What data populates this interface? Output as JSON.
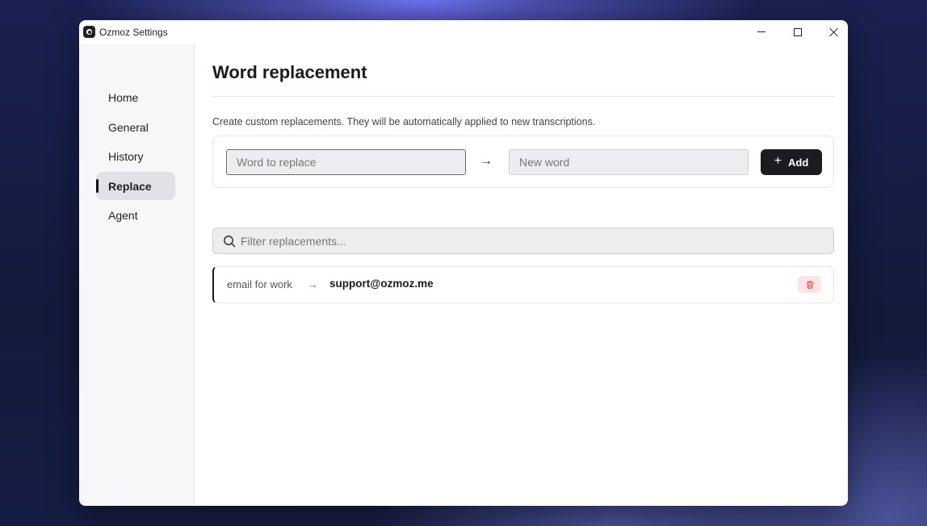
{
  "window": {
    "title": "Ozmoz Settings"
  },
  "sidebar": {
    "items": [
      {
        "label": "Home",
        "active": false
      },
      {
        "label": "General",
        "active": false
      },
      {
        "label": "History",
        "active": false
      },
      {
        "label": "Replace",
        "active": true
      },
      {
        "label": "Agent",
        "active": false
      }
    ]
  },
  "main": {
    "title": "Word replacement",
    "description": "Create custom replacements. They will be automatically applied to new transcriptions.",
    "add_form": {
      "from_placeholder": "Word to replace",
      "from_value": "",
      "arrow": "→",
      "to_placeholder": "New word",
      "to_value": "",
      "add_label": "Add",
      "add_icon": "plus-icon"
    },
    "filter": {
      "placeholder": "Filter replacements...",
      "value": "",
      "icon": "search-icon"
    },
    "replacements": [
      {
        "from": "email for work",
        "arrow": "→",
        "to": "support@ozmoz.me",
        "delete_icon": "trash-icon"
      }
    ]
  },
  "colors": {
    "accent": "#1c1c1e",
    "danger_bg": "#fde4e4",
    "danger": "#e5484d"
  }
}
